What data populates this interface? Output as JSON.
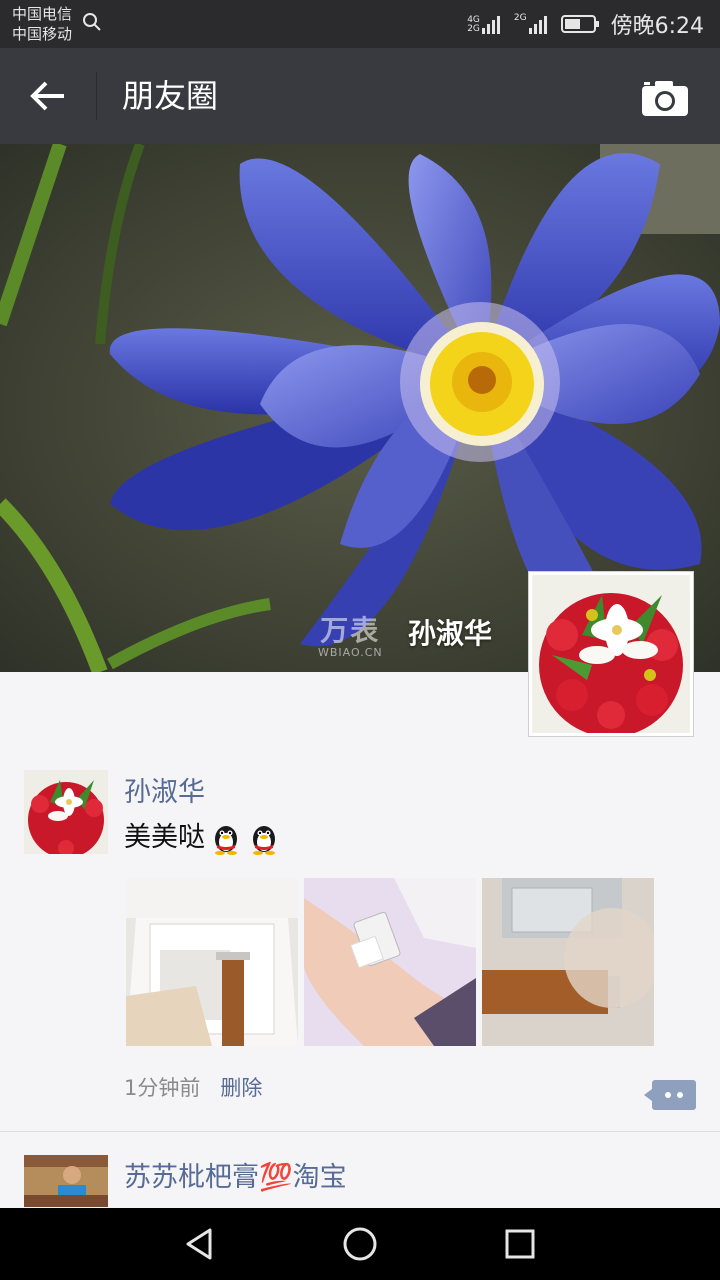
{
  "status_bar": {
    "carrier1": "中国电信",
    "carrier2": "中国移动",
    "net1_top": "4G",
    "net1_bottom": "2G",
    "net2": "2G",
    "time": "傍晚6:24"
  },
  "header": {
    "title": "朋友圈"
  },
  "cover": {
    "watermark": "万表",
    "watermark_sub": "WBIAO.CN",
    "user_name": "孙淑华"
  },
  "posts": [
    {
      "author": "孙淑华",
      "text": "美美哒",
      "timestamp": "1分钟前",
      "delete_label": "删除"
    },
    {
      "author": "苏苏枇杷膏💯淘宝"
    }
  ],
  "colors": {
    "link": "#576b95",
    "titlebar": "#393a3f",
    "statusbar": "#2b2b2d"
  }
}
